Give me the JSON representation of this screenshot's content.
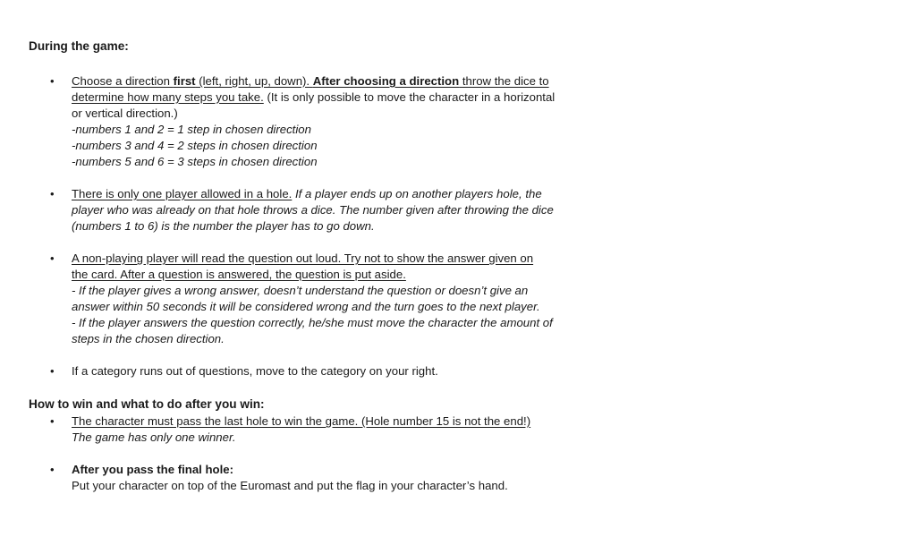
{
  "headings": {
    "during": "During the game:",
    "win": "How to win and what to do after you win:"
  },
  "bullet_glyph": "•",
  "item1": {
    "l1_a": "Choose a direction ",
    "l1_b": "first",
    "l1_c": " (left, right, up, down). ",
    "l1_d": "After choosing a direction",
    "l1_e": " throw the dice to",
    "l2_a": "determine how many steps you take.",
    "l2_b": " (It is only possible to move the character in a horizontal",
    "l3": "or vertical direction.)",
    "l4": "-numbers 1 and 2 = 1 step in chosen direction",
    "l5": "-numbers 3 and 4 = 2 steps in chosen direction",
    "l6": "-numbers 5 and 6 = 3 steps in chosen direction"
  },
  "item2": {
    "l1_a": "There is only one player allowed in a hole.",
    "l1_b": " If a player ends up on another players hole, the",
    "l2": "player who was already on that hole throws a dice. The number given after throwing the dice",
    "l3": "(numbers 1 to 6) is the number the player has to go down."
  },
  "item3": {
    "l1": "A non-playing player will read the question out loud. Try not to show the answer given on",
    "l2": "the card. After a question is answered, the question is put aside.",
    "l3": "- If the player gives a wrong answer, doesn’t understand the question or doesn’t give an",
    "l4": "answer within 50 seconds it will be considered wrong and the turn goes to the next player.",
    "l5": "- If the player answers the question correctly, he/she must move the character the amount of",
    "l6": "steps in the chosen direction."
  },
  "item4": {
    "l1": "If a category runs out of questions, move to the category on your right."
  },
  "item5": {
    "l1": "The character must pass the last hole to win the game. (Hole number 15 is not the end!)",
    "l2": "The game has only one winner."
  },
  "item6": {
    "l1": "After you pass the final hole:",
    "l2": "Put your character on top of the Euromast and put the flag in your character’s hand."
  }
}
